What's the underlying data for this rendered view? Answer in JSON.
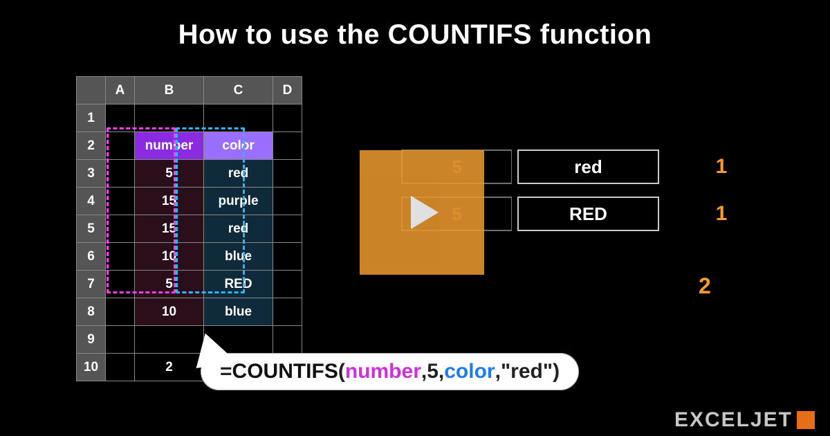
{
  "title": "How to use the COUNTIFS function",
  "columns": [
    "A",
    "B",
    "C",
    "D"
  ],
  "rows": [
    "1",
    "2",
    "3",
    "4",
    "5",
    "6",
    "7",
    "8",
    "9",
    "10"
  ],
  "headers": {
    "number": "number",
    "color": "color"
  },
  "data": [
    {
      "num": "5",
      "col": "red"
    },
    {
      "num": "15",
      "col": "purple"
    },
    {
      "num": "15",
      "col": "red"
    },
    {
      "num": "10",
      "col": "blue"
    },
    {
      "num": "5",
      "col": "RED"
    },
    {
      "num": "10",
      "col": "blue"
    }
  ],
  "result_cell": "2",
  "criteria": [
    {
      "num": "5",
      "text": "red",
      "result": "1"
    },
    {
      "num": "5",
      "text": "RED",
      "result": "1"
    }
  ],
  "criteria_total": "2",
  "formula": {
    "eq": "=",
    "fn": "COUNTIFS",
    "open": "(",
    "arg1": "number",
    "c1": ",",
    "arg2": "5",
    "c2": ",",
    "arg3": "color",
    "c3": ",",
    "arg4": "\"red\"",
    "close": ")"
  },
  "brand": "EXCELJET"
}
